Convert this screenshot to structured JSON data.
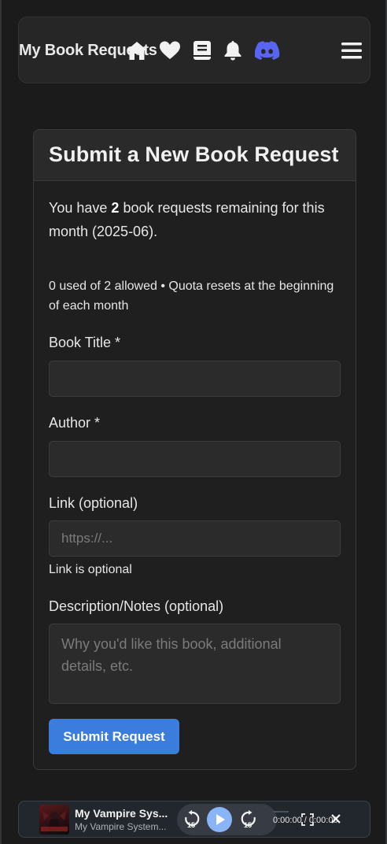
{
  "header": {
    "brand": "My Book Requests",
    "icons": [
      "home-icon",
      "heart-icon",
      "book-icon",
      "bell-icon",
      "discord-icon",
      "menu-icon"
    ],
    "discord_color": "#5865f2"
  },
  "card": {
    "title": "Submit a New Book Request",
    "quota_prefix": "You have ",
    "quota_count": "2",
    "quota_suffix": " book requests remaining for this month (2025-06).",
    "quota_sub": "0 used of 2 allowed • Quota resets at the beginning of each month",
    "book_title_label": "Book Title *",
    "book_title_value": "",
    "author_label": "Author *",
    "author_value": "",
    "link_label": "Link (optional)",
    "link_placeholder": "https://...",
    "link_helper": "Link is optional",
    "desc_label": "Description/Notes (optional)",
    "desc_placeholder": "Why you'd like this book, additional details, etc.",
    "submit_label": "Submit Request",
    "accent": "#3b7ddd"
  },
  "player": {
    "title": "My Vampire Sys...",
    "subtitle": "My Vampire System...",
    "rewind_seconds": "15",
    "forward_seconds": "15",
    "time": "0:00:00 / 0:00:00",
    "progress": 0
  }
}
